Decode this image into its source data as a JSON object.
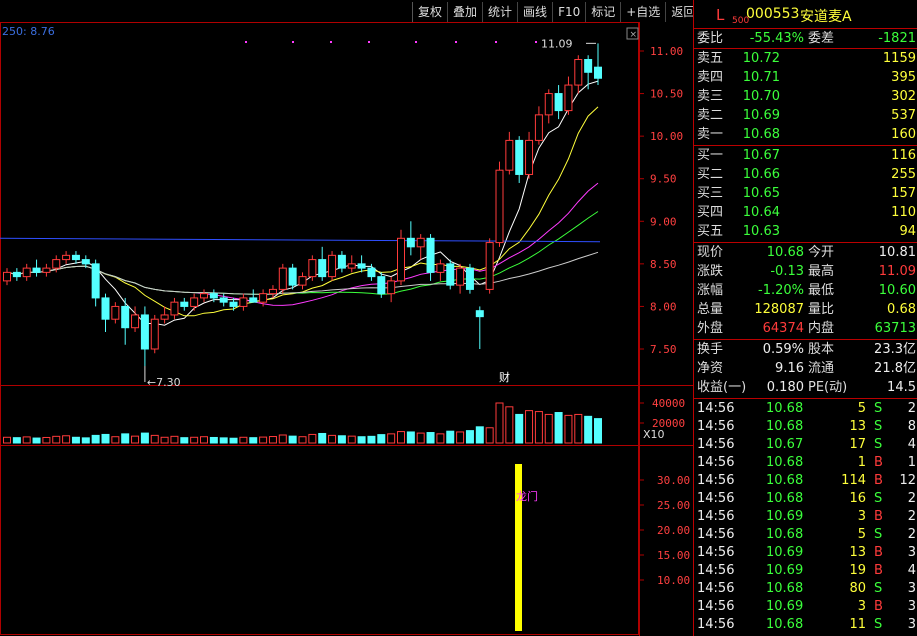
{
  "toolbar": {
    "buttons": [
      "复权",
      "叠加",
      "统计",
      "画线",
      "F10",
      "标记",
      "+自选",
      "返回"
    ]
  },
  "ma_label": "250: 8.76",
  "price_chart": {
    "y_ticks": [
      "11.00",
      "10.50",
      "10.00",
      "9.50",
      "9.00",
      "8.50",
      "8.00",
      "7.50"
    ],
    "y_values": [
      11.0,
      10.5,
      10.0,
      9.5,
      9.0,
      8.5,
      8.0,
      7.5
    ],
    "high_marker": "11.09",
    "low_marker": "7.30",
    "finance_marker": "财"
  },
  "volume_chart": {
    "y_ticks": [
      "40000",
      "20000"
    ],
    "unit_label": "X10"
  },
  "indicator_chart": {
    "y_ticks": [
      "30.00",
      "25.00",
      "20.00",
      "15.00",
      "10.00"
    ],
    "label": "龙门"
  },
  "quote": {
    "prefix": "L",
    "sub": "500",
    "code": "000553",
    "name": "安道麦A",
    "weibi_label": "委比",
    "weibi_value": "-55.43%",
    "weicha_label": "委差",
    "weicha_value": "-1821",
    "asks": [
      {
        "label": "卖五",
        "price": "10.72",
        "vol": "1159"
      },
      {
        "label": "卖四",
        "price": "10.71",
        "vol": "395"
      },
      {
        "label": "卖三",
        "price": "10.70",
        "vol": "302"
      },
      {
        "label": "卖二",
        "price": "10.69",
        "vol": "537"
      },
      {
        "label": "卖一",
        "price": "10.68",
        "vol": "160"
      }
    ],
    "bids": [
      {
        "label": "买一",
        "price": "10.67",
        "vol": "116"
      },
      {
        "label": "买二",
        "price": "10.66",
        "vol": "255"
      },
      {
        "label": "买三",
        "price": "10.65",
        "vol": "157"
      },
      {
        "label": "买四",
        "price": "10.64",
        "vol": "110"
      },
      {
        "label": "买五",
        "price": "10.63",
        "vol": "94"
      }
    ],
    "stats": [
      {
        "l1": "现价",
        "v1": "10.68",
        "c1": "green",
        "l2": "今开",
        "v2": "10.81",
        "c2": "white"
      },
      {
        "l1": "涨跌",
        "v1": "-0.13",
        "c1": "green",
        "l2": "最高",
        "v2": "11.09",
        "c2": "red"
      },
      {
        "l1": "涨幅",
        "v1": "-1.20%",
        "c1": "green",
        "l2": "最低",
        "v2": "10.60",
        "c2": "green"
      },
      {
        "l1": "总量",
        "v1": "128087",
        "c1": "yellow",
        "l2": "量比",
        "v2": "0.68",
        "c2": "yellow"
      },
      {
        "l1": "外盘",
        "v1": "64374",
        "c1": "red",
        "l2": "内盘",
        "v2": "63713",
        "c2": "green"
      }
    ],
    "stats2": [
      {
        "l1": "换手",
        "v1": "0.59%",
        "l2": "股本",
        "v2": "23.3亿"
      },
      {
        "l1": "净资",
        "v1": "9.16",
        "l2": "流通",
        "v2": "21.8亿"
      },
      {
        "l1": "收益(一)",
        "v1": "0.180",
        "l2": "PE(动)",
        "v2": "14.5"
      }
    ],
    "trades": [
      {
        "time": "14:56",
        "price": "10.68",
        "vol": "5",
        "bs": "S",
        "n": "2"
      },
      {
        "time": "14:56",
        "price": "10.68",
        "vol": "13",
        "bs": "S",
        "n": "8"
      },
      {
        "time": "14:56",
        "price": "10.67",
        "vol": "17",
        "bs": "S",
        "n": "4"
      },
      {
        "time": "14:56",
        "price": "10.68",
        "vol": "1",
        "bs": "B",
        "n": "1"
      },
      {
        "time": "14:56",
        "price": "10.68",
        "vol": "114",
        "bs": "B",
        "n": "12"
      },
      {
        "time": "14:56",
        "price": "10.68",
        "vol": "16",
        "bs": "S",
        "n": "2"
      },
      {
        "time": "14:56",
        "price": "10.69",
        "vol": "3",
        "bs": "B",
        "n": "2"
      },
      {
        "time": "14:56",
        "price": "10.68",
        "vol": "5",
        "bs": "S",
        "n": "2"
      },
      {
        "time": "14:56",
        "price": "10.69",
        "vol": "13",
        "bs": "B",
        "n": "3"
      },
      {
        "time": "14:56",
        "price": "10.69",
        "vol": "19",
        "bs": "B",
        "n": "4"
      },
      {
        "time": "14:56",
        "price": "10.68",
        "vol": "80",
        "bs": "S",
        "n": "3"
      },
      {
        "time": "14:56",
        "price": "10.69",
        "vol": "3",
        "bs": "B",
        "n": "3"
      },
      {
        "time": "14:56",
        "price": "10.68",
        "vol": "11",
        "bs": "S",
        "n": "3"
      }
    ]
  },
  "candles": [
    [
      8.3,
      8.45,
      8.25,
      8.4
    ],
    [
      8.4,
      8.45,
      8.3,
      8.35
    ],
    [
      8.35,
      8.5,
      8.3,
      8.45
    ],
    [
      8.45,
      8.55,
      8.35,
      8.4
    ],
    [
      8.4,
      8.5,
      8.35,
      8.45
    ],
    [
      8.45,
      8.6,
      8.4,
      8.55
    ],
    [
      8.55,
      8.65,
      8.5,
      8.6
    ],
    [
      8.6,
      8.65,
      8.5,
      8.55
    ],
    [
      8.55,
      8.6,
      8.45,
      8.5
    ],
    [
      8.5,
      8.55,
      8.0,
      8.1
    ],
    [
      8.1,
      8.15,
      7.7,
      7.85
    ],
    [
      7.85,
      8.05,
      7.8,
      8.0
    ],
    [
      8.0,
      8.1,
      7.55,
      7.75
    ],
    [
      7.75,
      8.0,
      7.7,
      7.9
    ],
    [
      7.9,
      8.0,
      7.3,
      7.5
    ],
    [
      7.5,
      7.9,
      7.45,
      7.85
    ],
    [
      7.85,
      8.0,
      7.8,
      7.9
    ],
    [
      7.9,
      8.1,
      7.85,
      8.05
    ],
    [
      8.05,
      8.1,
      7.95,
      8.0
    ],
    [
      8.0,
      8.15,
      7.95,
      8.1
    ],
    [
      8.1,
      8.2,
      8.05,
      8.15
    ],
    [
      8.15,
      8.2,
      8.05,
      8.1
    ],
    [
      8.1,
      8.15,
      8.0,
      8.05
    ],
    [
      8.05,
      8.1,
      7.95,
      8.0
    ],
    [
      8.0,
      8.15,
      7.95,
      8.1
    ],
    [
      8.1,
      8.2,
      8.05,
      8.05
    ],
    [
      8.05,
      8.2,
      8.0,
      8.15
    ],
    [
      8.15,
      8.25,
      8.1,
      8.2
    ],
    [
      8.2,
      8.5,
      8.15,
      8.45
    ],
    [
      8.45,
      8.5,
      8.2,
      8.25
    ],
    [
      8.25,
      8.4,
      8.2,
      8.35
    ],
    [
      8.35,
      8.6,
      8.3,
      8.55
    ],
    [
      8.55,
      8.7,
      8.3,
      8.35
    ],
    [
      8.35,
      8.65,
      8.3,
      8.6
    ],
    [
      8.6,
      8.65,
      8.4,
      8.45
    ],
    [
      8.45,
      8.6,
      8.4,
      8.5
    ],
    [
      8.5,
      8.6,
      8.4,
      8.45
    ],
    [
      8.45,
      8.5,
      8.3,
      8.35
    ],
    [
      8.35,
      8.4,
      8.1,
      8.15
    ],
    [
      8.15,
      8.35,
      8.05,
      8.3
    ],
    [
      8.3,
      8.9,
      8.25,
      8.8
    ],
    [
      8.8,
      9.0,
      8.6,
      8.7
    ],
    [
      8.7,
      8.85,
      8.55,
      8.8
    ],
    [
      8.8,
      8.85,
      8.3,
      8.4
    ],
    [
      8.4,
      8.55,
      8.3,
      8.5
    ],
    [
      8.5,
      8.55,
      8.2,
      8.25
    ],
    [
      8.25,
      8.5,
      8.15,
      8.45
    ],
    [
      8.45,
      8.5,
      8.15,
      8.2
    ],
    [
      7.95,
      8.0,
      7.5,
      7.88
    ],
    [
      8.2,
      8.8,
      8.15,
      8.75
    ],
    [
      8.75,
      9.7,
      8.7,
      9.6
    ],
    [
      9.6,
      10.05,
      9.55,
      9.95
    ],
    [
      9.95,
      10.0,
      9.45,
      9.55
    ],
    [
      9.55,
      10.05,
      9.5,
      9.95
    ],
    [
      9.95,
      10.35,
      9.9,
      10.25
    ],
    [
      10.25,
      10.55,
      10.15,
      10.5
    ],
    [
      10.5,
      10.6,
      10.2,
      10.3
    ],
    [
      10.3,
      10.7,
      10.25,
      10.6
    ],
    [
      10.6,
      10.95,
      10.5,
      10.9
    ],
    [
      10.9,
      10.95,
      10.55,
      10.75
    ],
    [
      10.81,
      11.09,
      10.6,
      10.68
    ]
  ],
  "volumes": [
    30,
    28,
    32,
    26,
    29,
    35,
    38,
    30,
    27,
    40,
    45,
    33,
    48,
    36,
    52,
    40,
    30,
    35,
    28,
    30,
    33,
    29,
    27,
    25,
    30,
    28,
    31,
    34,
    42,
    36,
    33,
    45,
    50,
    40,
    38,
    36,
    33,
    35,
    44,
    48,
    60,
    58,
    52,
    55,
    48,
    62,
    58,
    65,
    85,
    80,
    210,
    190,
    150,
    170,
    165,
    150,
    160,
    145,
    150,
    140,
    128
  ],
  "colors": {
    "up": "#ff3b3b",
    "down": "#54ffff",
    "ma5": "#ffffff",
    "ma10": "#ffff3b",
    "ma20": "#ff3bff",
    "ma30": "#3bff3b",
    "ma60": "#cccccc",
    "ma250": "#2f4fff",
    "axis": "#b00000"
  }
}
